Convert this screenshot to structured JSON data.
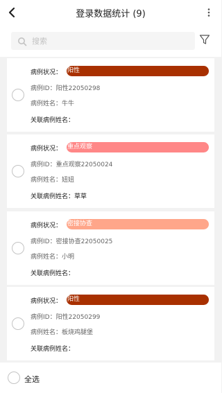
{
  "header": {
    "title": "登录数据统计 (9)"
  },
  "search": {
    "placeholder": "搜索"
  },
  "colors": {
    "阳性": "#a83000",
    "重点观察": "#ff8787",
    "密接协查": "#ffa68a"
  },
  "labels": {
    "status": "病例状况：",
    "id": "病例ID：",
    "name": "病例姓名：",
    "related": "关联病例姓名："
  },
  "cases": [
    {
      "status": "阳性",
      "id": "阳性22050298",
      "name": "牛牛",
      "related": ""
    },
    {
      "status": "重点观察",
      "id": "重点观察22050024",
      "name": "妞妞",
      "related": "草草"
    },
    {
      "status": "密接协查",
      "id": "密接协查22050025",
      "name": "小明",
      "related": ""
    },
    {
      "status": "阳性",
      "id": "阳性22050299",
      "name": "板烧鸡腿堡",
      "related": ""
    }
  ],
  "footer": {
    "select_all": "全选"
  }
}
